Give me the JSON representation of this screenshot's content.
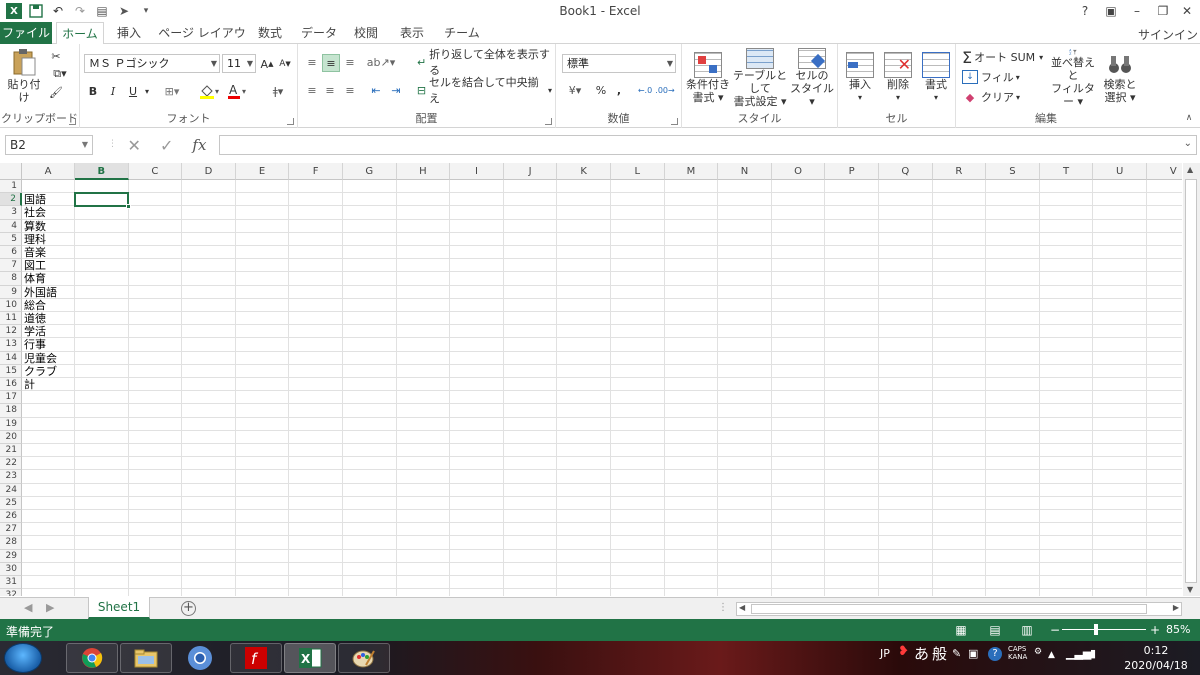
{
  "window": {
    "title": "Book1 - Excel",
    "help": "?",
    "minimize": "–",
    "restore": "❐",
    "close": "✕"
  },
  "tabs": [
    {
      "label": "ファイル",
      "id": "file"
    },
    {
      "label": "ホーム",
      "id": "home"
    },
    {
      "label": "挿入",
      "id": "insert"
    },
    {
      "label": "ページ レイアウト",
      "id": "page-layout"
    },
    {
      "label": "数式",
      "id": "formulas"
    },
    {
      "label": "データ",
      "id": "data"
    },
    {
      "label": "校閲",
      "id": "review"
    },
    {
      "label": "表示",
      "id": "view"
    },
    {
      "label": "チーム",
      "id": "team"
    }
  ],
  "signin": "サインイン",
  "ribbon": {
    "clipboard": {
      "label": "クリップボード",
      "paste": "貼り付け"
    },
    "font": {
      "label": "フォント",
      "name": "ＭＳ Ｐゴシック",
      "size": "11",
      "bold": "B",
      "italic": "I",
      "underline": "U"
    },
    "alignment": {
      "label": "配置",
      "wrap": "折り返して全体を表示する",
      "merge": "セルを結合して中央揃え"
    },
    "number": {
      "label": "数値",
      "format": "標準",
      "percent": "%",
      "comma": ","
    },
    "styles": {
      "label": "スタイル",
      "conditional": [
        "条件付き",
        "書式"
      ],
      "table": [
        "テーブルとして",
        "書式設定"
      ],
      "cell": [
        "セルの",
        "スタイル"
      ]
    },
    "cells": {
      "label": "セル",
      "insert": "挿入",
      "delete": "削除",
      "format": "書式"
    },
    "editing": {
      "label": "編集",
      "autosum": "オート SUM",
      "fill": "フィル",
      "clear": "クリア",
      "sort": [
        "並べ替えと",
        "フィルター"
      ],
      "find": [
        "検索と",
        "選択"
      ]
    }
  },
  "formula_bar": {
    "name_box": "B2",
    "fx": "fx",
    "value": ""
  },
  "grid": {
    "columns": [
      "A",
      "B",
      "C",
      "D",
      "E",
      "F",
      "G",
      "H",
      "I",
      "J",
      "K",
      "L",
      "M",
      "N",
      "O",
      "P",
      "Q",
      "R",
      "S",
      "T",
      "U",
      "V"
    ],
    "selected_column": "B",
    "selected_row": 2,
    "row_count": 32,
    "cells_A": {
      "2": "国語",
      "3": "社会",
      "4": "算数",
      "5": "理科",
      "6": "音楽",
      "7": "図工",
      "8": "体育",
      "9": "外国語",
      "10": "総合",
      "11": "道徳",
      "12": "学活",
      "13": "行事",
      "14": "児童会",
      "15": "クラブ",
      "16": "計"
    }
  },
  "sheets": {
    "tabs": [
      "Sheet1"
    ],
    "add": "+"
  },
  "status": {
    "text": "準備完了",
    "zoom": "85%",
    "zoom_out": "−",
    "zoom_in": "+"
  },
  "taskbar": {
    "tray_lang": "JP",
    "ime_mode": "あ",
    "ime_kanji": "般",
    "caps": "CAPS",
    "kana": "KANA",
    "time": "0:12",
    "date": "2020/04/18"
  },
  "colors": {
    "accent": "#217346",
    "grid_line": "#e1e1e1",
    "header_bg": "#f3f3f3"
  }
}
